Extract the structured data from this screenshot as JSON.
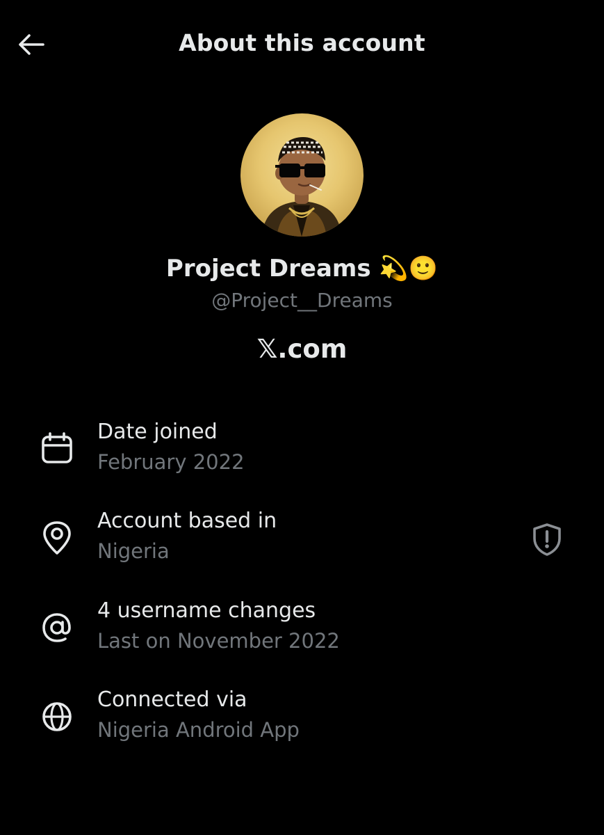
{
  "header": {
    "title": "About this account",
    "back_icon": "arrow-left-icon"
  },
  "profile": {
    "avatar_icon": "profile-avatar-bitmoji",
    "display_name": "Project Dreams 💫🙂",
    "handle": "@Project__Dreams",
    "verified_domain": "𝕏.com"
  },
  "details": [
    {
      "icon": "calendar-icon",
      "label": "Date joined",
      "value": "February 2022"
    },
    {
      "icon": "location-pin-icon",
      "label": "Account based in",
      "value": "Nigeria"
    },
    {
      "icon": "at-sign-icon",
      "label": "4 username changes",
      "value": "Last on November 2022"
    },
    {
      "icon": "globe-icon",
      "label": "Connected via",
      "value": "Nigeria Android App"
    }
  ],
  "colors": {
    "background": "#000000",
    "primary_text": "#e7e9ea",
    "secondary_text": "#71767b",
    "icon": "#e7e9ea",
    "shield_icon": "#8b8f94"
  }
}
